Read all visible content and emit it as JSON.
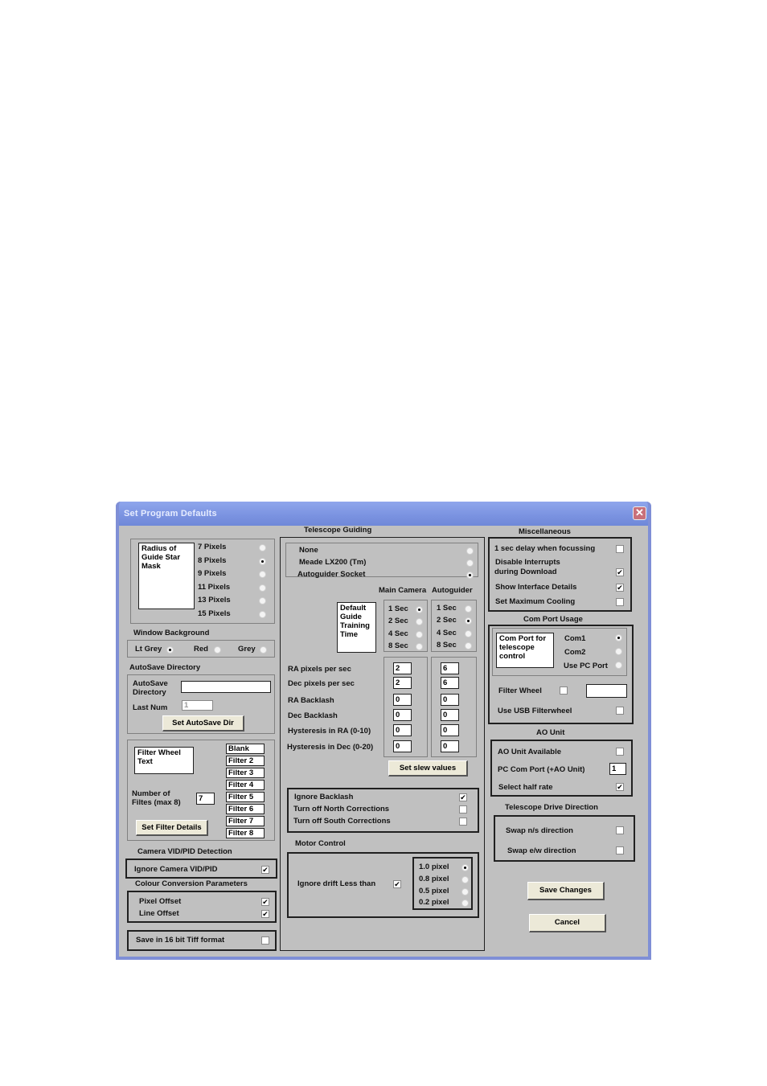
{
  "window": {
    "title": "Set Program Defaults",
    "close_icon": "close-x-icon",
    "colors": {
      "titlebar": "#7a92e0",
      "frame": "#7f8fd6",
      "body": "#c0c0c0",
      "close": "#c9707a"
    }
  },
  "guide_mask": {
    "memo_text": "Radius of Guide Star Mask",
    "options": [
      {
        "label": "7 Pixels",
        "selected": false
      },
      {
        "label": "8 Pixels",
        "selected": true
      },
      {
        "label": "9 Pixels",
        "selected": false
      },
      {
        "label": "11 Pixels",
        "selected": false
      },
      {
        "label": "13 Pixels",
        "selected": false
      },
      {
        "label": "15 Pixels",
        "selected": false
      }
    ]
  },
  "window_background": {
    "heading": "Window Background",
    "options": [
      {
        "label": "Lt Grey",
        "selected": true
      },
      {
        "label": "Red",
        "selected": false
      },
      {
        "label": "Grey",
        "selected": false
      }
    ]
  },
  "autosave": {
    "heading": "AutoSave Directory",
    "dir_label": "AutoSave Directory",
    "dir_value": "",
    "last_num_label": "Last Num",
    "last_num_value": "1",
    "button": "Set AutoSave Dir"
  },
  "filter_wheel": {
    "memo_text": "Filter Wheel Text",
    "count_label": "Number of Filtes (max 8)",
    "count_value": "7",
    "filters": [
      "Blank",
      "Filter 2",
      "Filter 3",
      "Filter 4",
      "Filter 5",
      "Filter 6",
      "Filter 7",
      "Filter 8"
    ],
    "button": "Set Filter Details"
  },
  "camera_vid": {
    "heading": "Camera VID/PID Detection",
    "ignore_label": "Ignore Camera VID/PID",
    "ignore_checked": true
  },
  "colour_conversion": {
    "heading": "Colour Conversion Parameters",
    "pixel_offset_label": "Pixel Offset",
    "pixel_offset_checked": true,
    "line_offset_label": "Line Offset",
    "line_offset_checked": true
  },
  "tiff": {
    "label": "Save in 16 bit Tiff format",
    "checked": false
  },
  "telescope_guiding": {
    "heading": "Telescope Guiding",
    "modes": [
      {
        "label": "None",
        "selected": false
      },
      {
        "label": "Meade LX200 (Tm)",
        "selected": false
      },
      {
        "label": "Autoguider Socket",
        "selected": true
      }
    ],
    "col_main": "Main Camera",
    "col_auto": "Autoguider",
    "training_memo": "Default Guide Training Time",
    "main_times": [
      {
        "label": "1 Sec",
        "selected": true
      },
      {
        "label": "2 Sec",
        "selected": false
      },
      {
        "label": "4 Sec",
        "selected": false
      },
      {
        "label": "8 Sec",
        "selected": false
      }
    ],
    "auto_times": [
      {
        "label": "1 Sec",
        "selected": false
      },
      {
        "label": "2 Sec",
        "selected": true
      },
      {
        "label": "4 Sec",
        "selected": false
      },
      {
        "label": "8 Sec",
        "selected": false
      }
    ],
    "params": [
      {
        "label": "RA pixels per sec",
        "main": "2",
        "auto": "6"
      },
      {
        "label": "Dec pixels per sec",
        "main": "2",
        "auto": "6"
      },
      {
        "label": "RA Backlash",
        "main": "0",
        "auto": "0"
      },
      {
        "label": "Dec Backlash",
        "main": "0",
        "auto": "0"
      },
      {
        "label": "Hysteresis in RA (0-10)",
        "main": "0",
        "auto": "0"
      },
      {
        "label": "Hysteresis in Dec (0-20)",
        "main": "0",
        "auto": "0"
      }
    ],
    "slew_button": "Set slew values",
    "backlash": [
      {
        "label": "Ignore Backlash",
        "checked": true
      },
      {
        "label": "Turn off North Corrections",
        "checked": false
      },
      {
        "label": "Turn off South Corrections",
        "checked": false
      }
    ]
  },
  "motor_control": {
    "heading": "Motor Control",
    "ignore_drift_label": "Ignore drift Less than",
    "ignore_drift_checked": true,
    "drift_options": [
      {
        "label": "1.0 pixel",
        "selected": true
      },
      {
        "label": "0.8 pixel",
        "selected": false
      },
      {
        "label": "0.5 pixel",
        "selected": false
      },
      {
        "label": "0.2 pixel",
        "selected": false
      }
    ]
  },
  "miscellaneous": {
    "heading": "Miscellaneous",
    "items": [
      {
        "label": "1 sec delay when focussing",
        "checked": false
      },
      {
        "label": "Disable Interrupts",
        "label2": "during Download",
        "checked": true
      },
      {
        "label": "Show Interface Details",
        "checked": true
      },
      {
        "label": "Set Maximum Cooling",
        "checked": false
      }
    ]
  },
  "com_port": {
    "heading": "Com Port Usage",
    "memo_text": "Com Port for telescope control",
    "options": [
      {
        "label": "Com1",
        "selected": true
      },
      {
        "label": "Com2",
        "selected": false
      },
      {
        "label": "Use PC Port",
        "selected": false
      }
    ],
    "filter_wheel_label": "Filter Wheel",
    "filter_wheel_checked": false,
    "filter_wheel_value": "",
    "usb_label": "Use USB Filterwheel",
    "usb_checked": false
  },
  "ao_unit": {
    "heading": "AO Unit",
    "available_label": "AO Unit Available",
    "available_checked": false,
    "com_port_label": "PC Com Port (+AO Unit)",
    "com_port_value": "1",
    "half_rate_label": "Select half rate",
    "half_rate_checked": true
  },
  "drive_direction": {
    "heading": "Telescope Drive Direction",
    "ns_label": "Swap n/s direction",
    "ns_checked": false,
    "ew_label": "Swap e/w direction",
    "ew_checked": false
  },
  "actions": {
    "save": "Save Changes",
    "cancel": "Cancel"
  },
  "check_glyph": "✔"
}
